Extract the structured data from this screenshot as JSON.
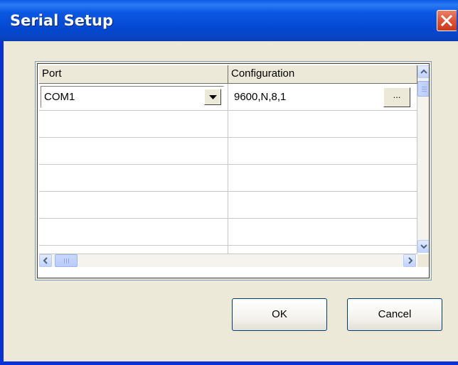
{
  "window": {
    "title": "Serial Setup"
  },
  "grid": {
    "columns": [
      "Port",
      "Configuration"
    ],
    "rows": [
      {
        "port": "COM1",
        "configuration": "9600,N,8,1",
        "ellipsis": "..."
      }
    ]
  },
  "buttons": {
    "ok": "OK",
    "cancel": "Cancel"
  },
  "colors": {
    "titlebar": "#0447d0",
    "close": "#e2563a",
    "dialog_bg": "#ece9d8"
  }
}
